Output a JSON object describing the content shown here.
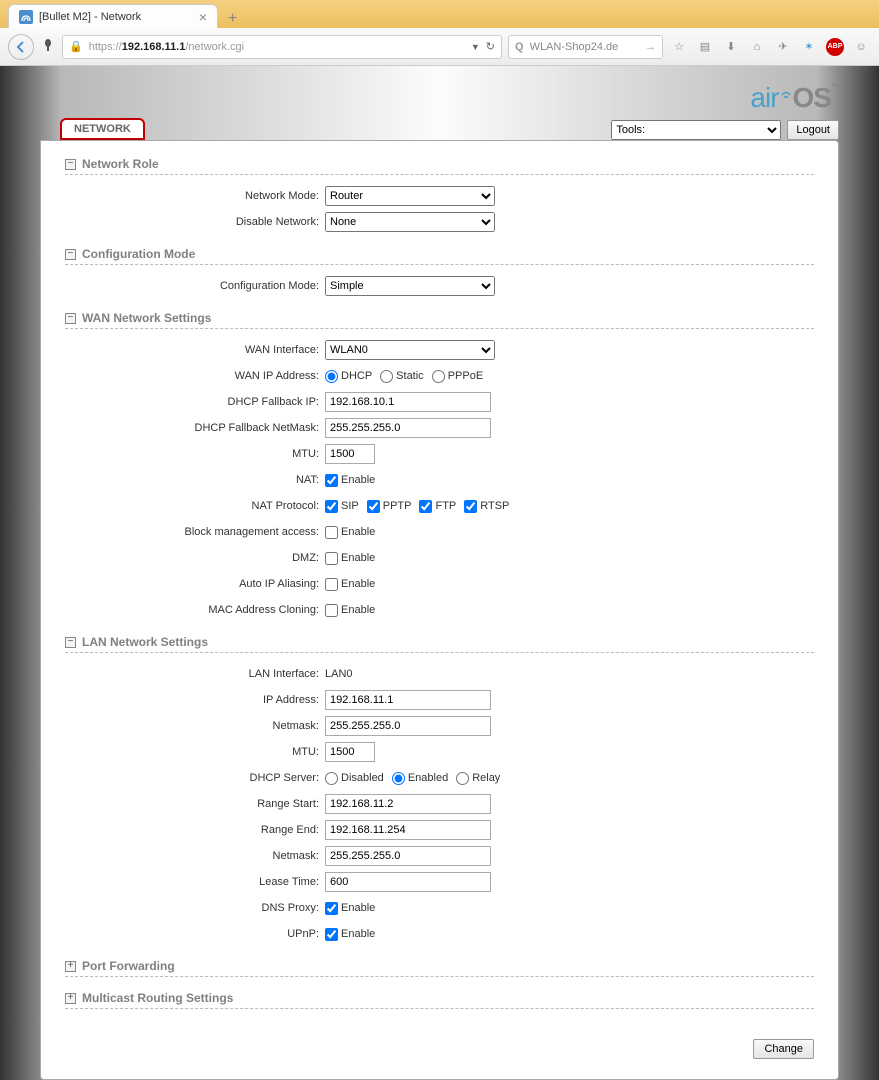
{
  "browser": {
    "tab_title": "[Bullet M2] - Network",
    "url_proto": "https://",
    "url_host": "192.168.11.1",
    "url_path": "/network.cgi",
    "search_placeholder": "WLAN-Shop24.de"
  },
  "logo": {
    "air": "air",
    "os": "OS",
    "tm": "™"
  },
  "topbar": {
    "active_tab": "NETWORK",
    "tools_label": "Tools:",
    "logout": "Logout"
  },
  "sections": {
    "role": {
      "title": "Network Role",
      "mode_label": "Network Mode:",
      "mode_value": "Router",
      "disable_label": "Disable Network:",
      "disable_value": "None"
    },
    "config": {
      "title": "Configuration Mode",
      "mode_label": "Configuration Mode:",
      "mode_value": "Simple"
    },
    "wan": {
      "title": "WAN Network Settings",
      "iface_label": "WAN Interface:",
      "iface_value": "WLAN0",
      "ipaddr_label": "WAN IP Address:",
      "radio_dhcp": "DHCP",
      "radio_static": "Static",
      "radio_pppoe": "PPPoE",
      "fallback_ip_label": "DHCP Fallback IP:",
      "fallback_ip": "192.168.10.1",
      "fallback_mask_label": "DHCP Fallback NetMask:",
      "fallback_mask": "255.255.255.0",
      "mtu_label": "MTU:",
      "mtu": "1500",
      "nat_label": "NAT:",
      "natproto_label": "NAT Protocol:",
      "sip": "SIP",
      "pptp": "PPTP",
      "ftp": "FTP",
      "rtsp": "RTSP",
      "block_label": "Block management access:",
      "dmz_label": "DMZ:",
      "autoip_label": "Auto IP Aliasing:",
      "macclone_label": "MAC Address Cloning:",
      "enable": "Enable"
    },
    "lan": {
      "title": "LAN Network Settings",
      "iface_label": "LAN Interface:",
      "iface_value": "LAN0",
      "ip_label": "IP Address:",
      "ip": "192.168.11.1",
      "mask_label": "Netmask:",
      "mask": "255.255.255.0",
      "mtu_label": "MTU:",
      "mtu": "1500",
      "dhcp_label": "DHCP Server:",
      "radio_disabled": "Disabled",
      "radio_enabled": "Enabled",
      "radio_relay": "Relay",
      "range_start_label": "Range Start:",
      "range_start": "192.168.11.2",
      "range_end_label": "Range End:",
      "range_end": "192.168.11.254",
      "mask2_label": "Netmask:",
      "mask2": "255.255.255.0",
      "lease_label": "Lease Time:",
      "lease": "600",
      "dnsproxy_label": "DNS Proxy:",
      "upnp_label": "UPnP:",
      "enable": "Enable"
    },
    "portfwd": {
      "title": "Port Forwarding"
    },
    "multicast": {
      "title": "Multicast Routing Settings"
    }
  },
  "change_btn": "Change"
}
